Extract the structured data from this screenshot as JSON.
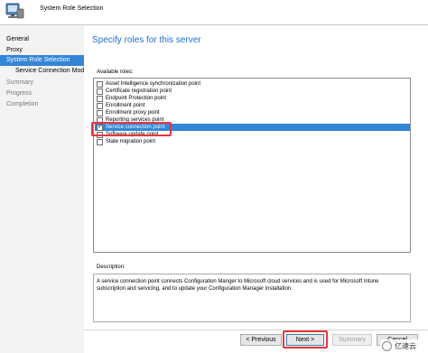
{
  "window": {
    "title": "System Role Selection"
  },
  "sidebar": {
    "items": [
      {
        "label": "General",
        "state": "normal"
      },
      {
        "label": "Proxy",
        "state": "normal"
      },
      {
        "label": "System Role Selection",
        "state": "active"
      },
      {
        "label": "Service Connection Mode",
        "state": "child"
      },
      {
        "label": "Summary",
        "state": "disabled"
      },
      {
        "label": "Progress",
        "state": "disabled"
      },
      {
        "label": "Completion",
        "state": "disabled"
      }
    ]
  },
  "main": {
    "heading": "Specify roles for this server",
    "roles_label": "Available roles:",
    "roles": [
      {
        "label": "Asset Intelligence synchronization point",
        "checked": false,
        "selected": false
      },
      {
        "label": "Certificate registration point",
        "checked": false,
        "selected": false
      },
      {
        "label": "Endpoint Protection point",
        "checked": false,
        "selected": false
      },
      {
        "label": "Enrollment point",
        "checked": false,
        "selected": false
      },
      {
        "label": "Enrollment proxy point",
        "checked": false,
        "selected": false
      },
      {
        "label": "Reporting services point",
        "checked": false,
        "selected": false
      },
      {
        "label": "Service connection point",
        "checked": true,
        "selected": true
      },
      {
        "label": "Software update point",
        "checked": false,
        "selected": false
      },
      {
        "label": "State migration point",
        "checked": false,
        "selected": false
      }
    ],
    "description_label": "Description:",
    "description": "A service connection point connects Configuration Manger to Microsoft cloud services and is used for Microsoft Intune subscription and servicing, and to update your Configuration Manager installation."
  },
  "footer": {
    "previous_label": "< Previous",
    "next_label": "Next >",
    "summary_label": "Summary",
    "cancel_label": "Cancel"
  },
  "watermark": {
    "text": "亿速云",
    "icon": "cloud-logo-icon"
  },
  "colors": {
    "accent": "#3385d6",
    "heading": "#1f6fd1",
    "highlight": "#e8353c",
    "sidebar_bg": "#f3f3f3"
  }
}
